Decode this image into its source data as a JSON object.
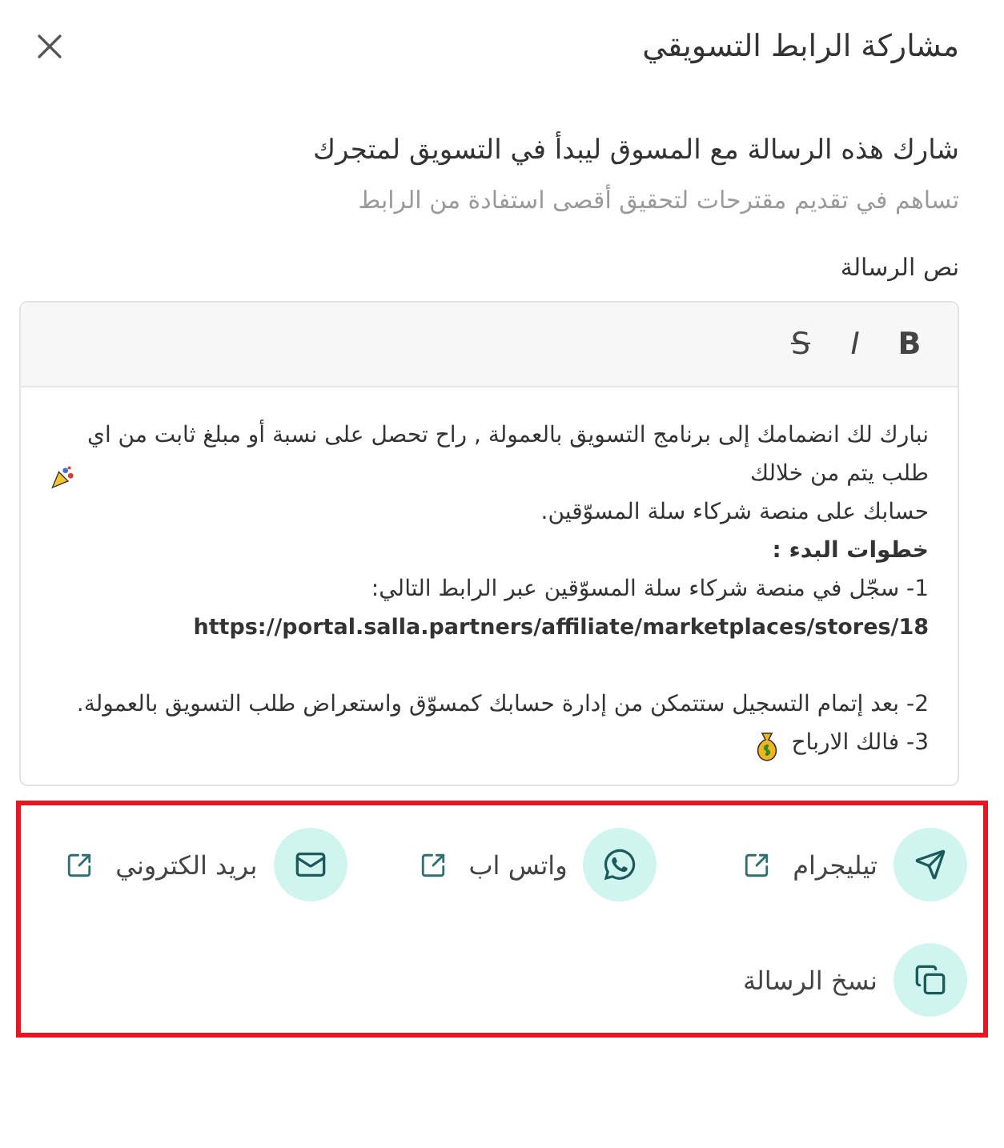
{
  "dialog": {
    "title": "مشاركة الرابط التسويقي"
  },
  "intro": {
    "heading": "شارك هذه الرسالة مع المسوق ليبدأ في التسويق لمتجرك",
    "subtext": "تساهم في تقديم مقترحات لتحقيق أقصى استفادة من الرابط"
  },
  "editor": {
    "label": "نص الرسالة",
    "tools": [
      {
        "kind": "bold",
        "label": "B"
      },
      {
        "kind": "italic",
        "label": "I"
      },
      {
        "kind": "strike",
        "label": "S"
      }
    ],
    "lines": [
      {
        "kind": "celebration",
        "text": "نبارك لك انضمامك إلى برنامج التسويق بالعمولة , راح تحصل على نسبة أو مبلغ ثابت من اي طلب يتم من خلالك"
      },
      {
        "kind": "text",
        "text": "حسابك على منصة شركاء سلة المسوّقين."
      },
      {
        "kind": "bold",
        "text": "خطوات البدء :"
      },
      {
        "kind": "text",
        "text": "1- سجّل في منصة شركاء سلة المسوّقين عبر الرابط التالي:"
      },
      {
        "kind": "link",
        "text": "https://portal.salla.partners/affiliate/marketplaces/stores/18"
      },
      {
        "kind": "blank"
      },
      {
        "kind": "text",
        "text": "2- بعد إتمام التسجيل ستتمكن من إدارة حسابك كمسوّق واستعراض طلب التسويق بالعمولة."
      },
      {
        "kind": "earnings",
        "text": "3- فالك الارباح"
      }
    ]
  },
  "share": {
    "highlighted": true,
    "options": [
      {
        "kind": "telegram",
        "label": "تيليجرام",
        "external": true
      },
      {
        "kind": "whatsapp",
        "label": "واتس اب",
        "external": true
      },
      {
        "kind": "email",
        "label": "بريد الكتروني",
        "external": true
      },
      {
        "kind": "copy",
        "label": "نسخ الرسالة",
        "external": false
      }
    ]
  }
}
